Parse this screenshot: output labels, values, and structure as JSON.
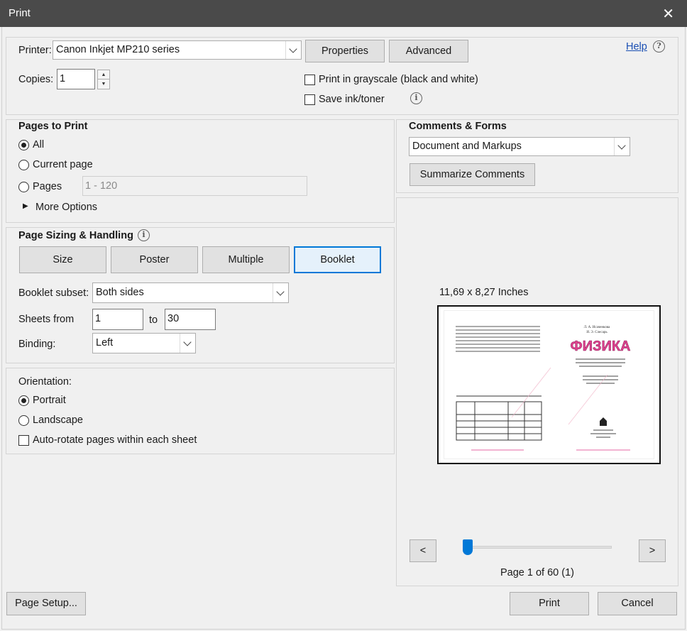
{
  "window": {
    "title": "Print",
    "close_glyph": "✕"
  },
  "printer": {
    "label": "Printer:",
    "selected": "Canon Inkjet MP210 series",
    "properties_label": "Properties",
    "advanced_label": "Advanced",
    "help_label": "Help",
    "copies_label": "Copies:",
    "copies_value": "1",
    "grayscale_label": "Print in grayscale (black and white)",
    "save_ink_label": "Save ink/toner"
  },
  "pages_to_print": {
    "title": "Pages to Print",
    "all_label": "All",
    "current_label": "Current page",
    "pages_label": "Pages",
    "pages_placeholder": "1 - 120",
    "more_options_label": "More Options"
  },
  "comments_forms": {
    "title": "Comments & Forms",
    "selected": "Document and Markups",
    "summarize_label": "Summarize Comments"
  },
  "sizing": {
    "title": "Page Sizing & Handling",
    "tabs": [
      "Size",
      "Poster",
      "Multiple",
      "Booklet"
    ],
    "active_tab": "Booklet",
    "booklet_subset_label": "Booklet subset:",
    "booklet_subset_value": "Both sides",
    "sheets_from_label": "Sheets from",
    "sheets_from_value": "1",
    "to_label": "to",
    "sheets_to_value": "30",
    "binding_label": "Binding:",
    "binding_value": "Left"
  },
  "orientation": {
    "title": "Orientation:",
    "portrait_label": "Portrait",
    "landscape_label": "Landscape",
    "autorotate_label": "Auto-rotate pages within each sheet"
  },
  "preview": {
    "size_label": "11,69 x 8,27 Inches",
    "book_title": "ФИЗИКА",
    "prev_label": "<",
    "next_label": ">",
    "page_indicator": "Page 1 of 60 (1)",
    "slider_position": 0.0
  },
  "footer": {
    "page_setup_label": "Page Setup...",
    "print_label": "Print",
    "cancel_label": "Cancel"
  },
  "colors": {
    "accent": "#0078d7",
    "titlebar": "#4a4a4a",
    "book_title": "#e0428f"
  }
}
